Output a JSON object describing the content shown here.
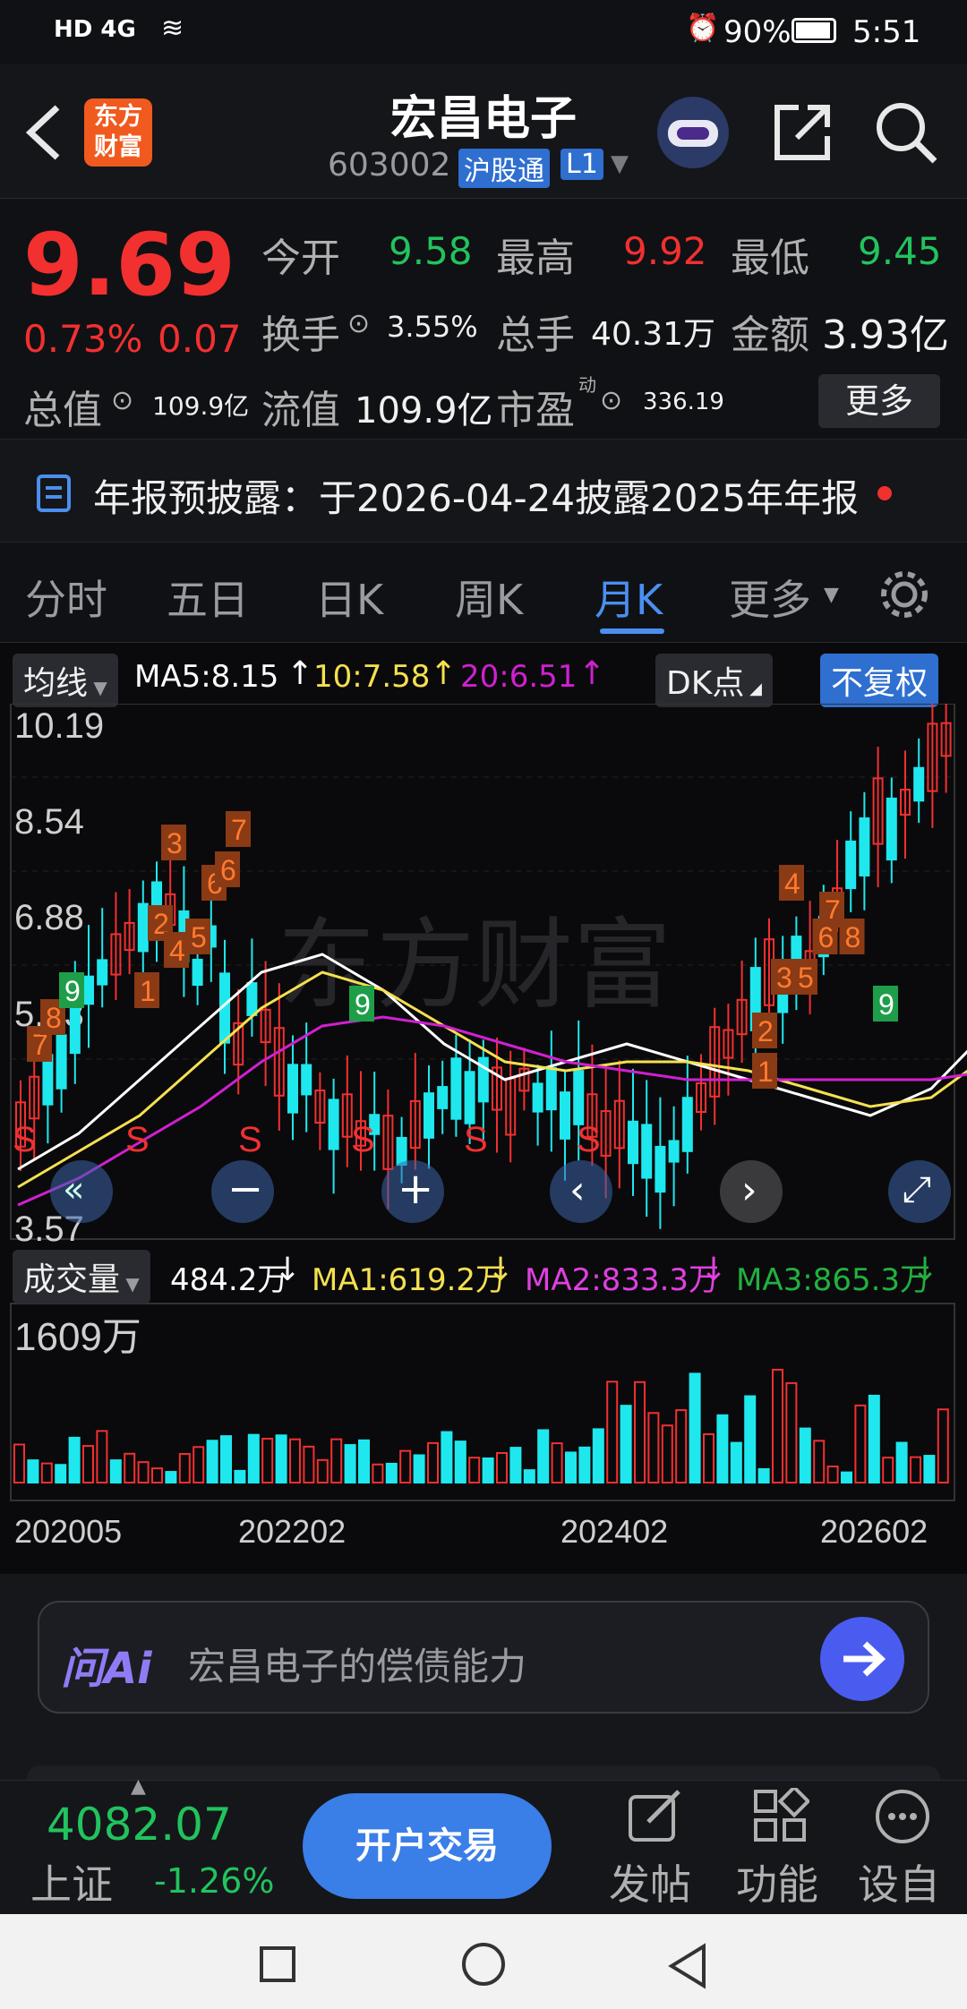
{
  "status_bar": {
    "left_icons": "HD 4G",
    "battery": "90%",
    "time": "5:51"
  },
  "header": {
    "title": "宏昌电子",
    "code": "603002",
    "badge": "沪股通",
    "level": "L1",
    "logo_line1": "东方",
    "logo_line2": "财富"
  },
  "quote": {
    "price": "9.69",
    "change_pct": "0.73%",
    "change": "0.07",
    "open_label": "今开",
    "open": "9.58",
    "high_label": "最高",
    "high": "9.92",
    "low_label": "最低",
    "low": "9.45",
    "turnover_label": "换手",
    "turnover": "3.55%",
    "volume_label": "总手",
    "volume": "40.31万",
    "amount_label": "金额",
    "amount": "3.93亿",
    "total_value_label": "总值",
    "total_value": "109.9亿",
    "float_value_label": "流值",
    "float_value": "109.9亿",
    "pe_label": "市盈",
    "pe_super": "动",
    "pe": "336.19",
    "more_label": "更多"
  },
  "notice": {
    "text": "年报预披露：于2026-04-24披露2025年年报"
  },
  "tabs": [
    {
      "label": "分时"
    },
    {
      "label": "五日"
    },
    {
      "label": "日K"
    },
    {
      "label": "周K"
    },
    {
      "label": "月K",
      "active": true
    },
    {
      "label": "更多"
    }
  ],
  "indicators": {
    "ma_label": "均线",
    "ma5": "MA5:8.15",
    "ma10": "10:7.58",
    "ma20": "20:6.51",
    "dk_label": "DK点",
    "fq_label": "不复权",
    "vol_label": "成交量",
    "vol_value": "484.2万",
    "vol_ma1": "MA1:619.2万",
    "vol_ma2": "MA2:833.3万",
    "vol_ma3": "MA3:865.3万"
  },
  "colors": {
    "up": "#f23030",
    "down": "#1ee8ee",
    "ma5": "#ffffff",
    "ma10": "#f5e050",
    "ma20": "#d020d0",
    "accent": "#4a8ff0"
  },
  "chart_data": {
    "type": "candlestick",
    "price_ticks": [
      "10.19",
      "8.54",
      "6.88",
      "5.23",
      "3.57"
    ],
    "volume_tick": "1609万",
    "x_ticks": [
      "202005",
      "202202",
      "202402",
      "202602"
    ],
    "watermark": "东方财富",
    "dk_tags": [
      "7",
      "8",
      "6",
      "9",
      "1",
      "2",
      "4",
      "5",
      "3",
      "6",
      "7",
      "9",
      "1",
      "2",
      "3",
      "5",
      "4",
      "7",
      "6",
      "8",
      "9"
    ],
    "sell_marks": [
      "S",
      "S",
      "S",
      "S",
      "S",
      "S"
    ]
  },
  "ai": {
    "brand": "问Ai",
    "prompt": "宏昌电子的偿债能力"
  },
  "bottom": {
    "index_value": "4082.07",
    "index_name": "上证",
    "index_change": "-1.26%",
    "trade_label": "开户交易",
    "post_label": "发帖",
    "func_label": "功能",
    "custom_label": "设自"
  }
}
